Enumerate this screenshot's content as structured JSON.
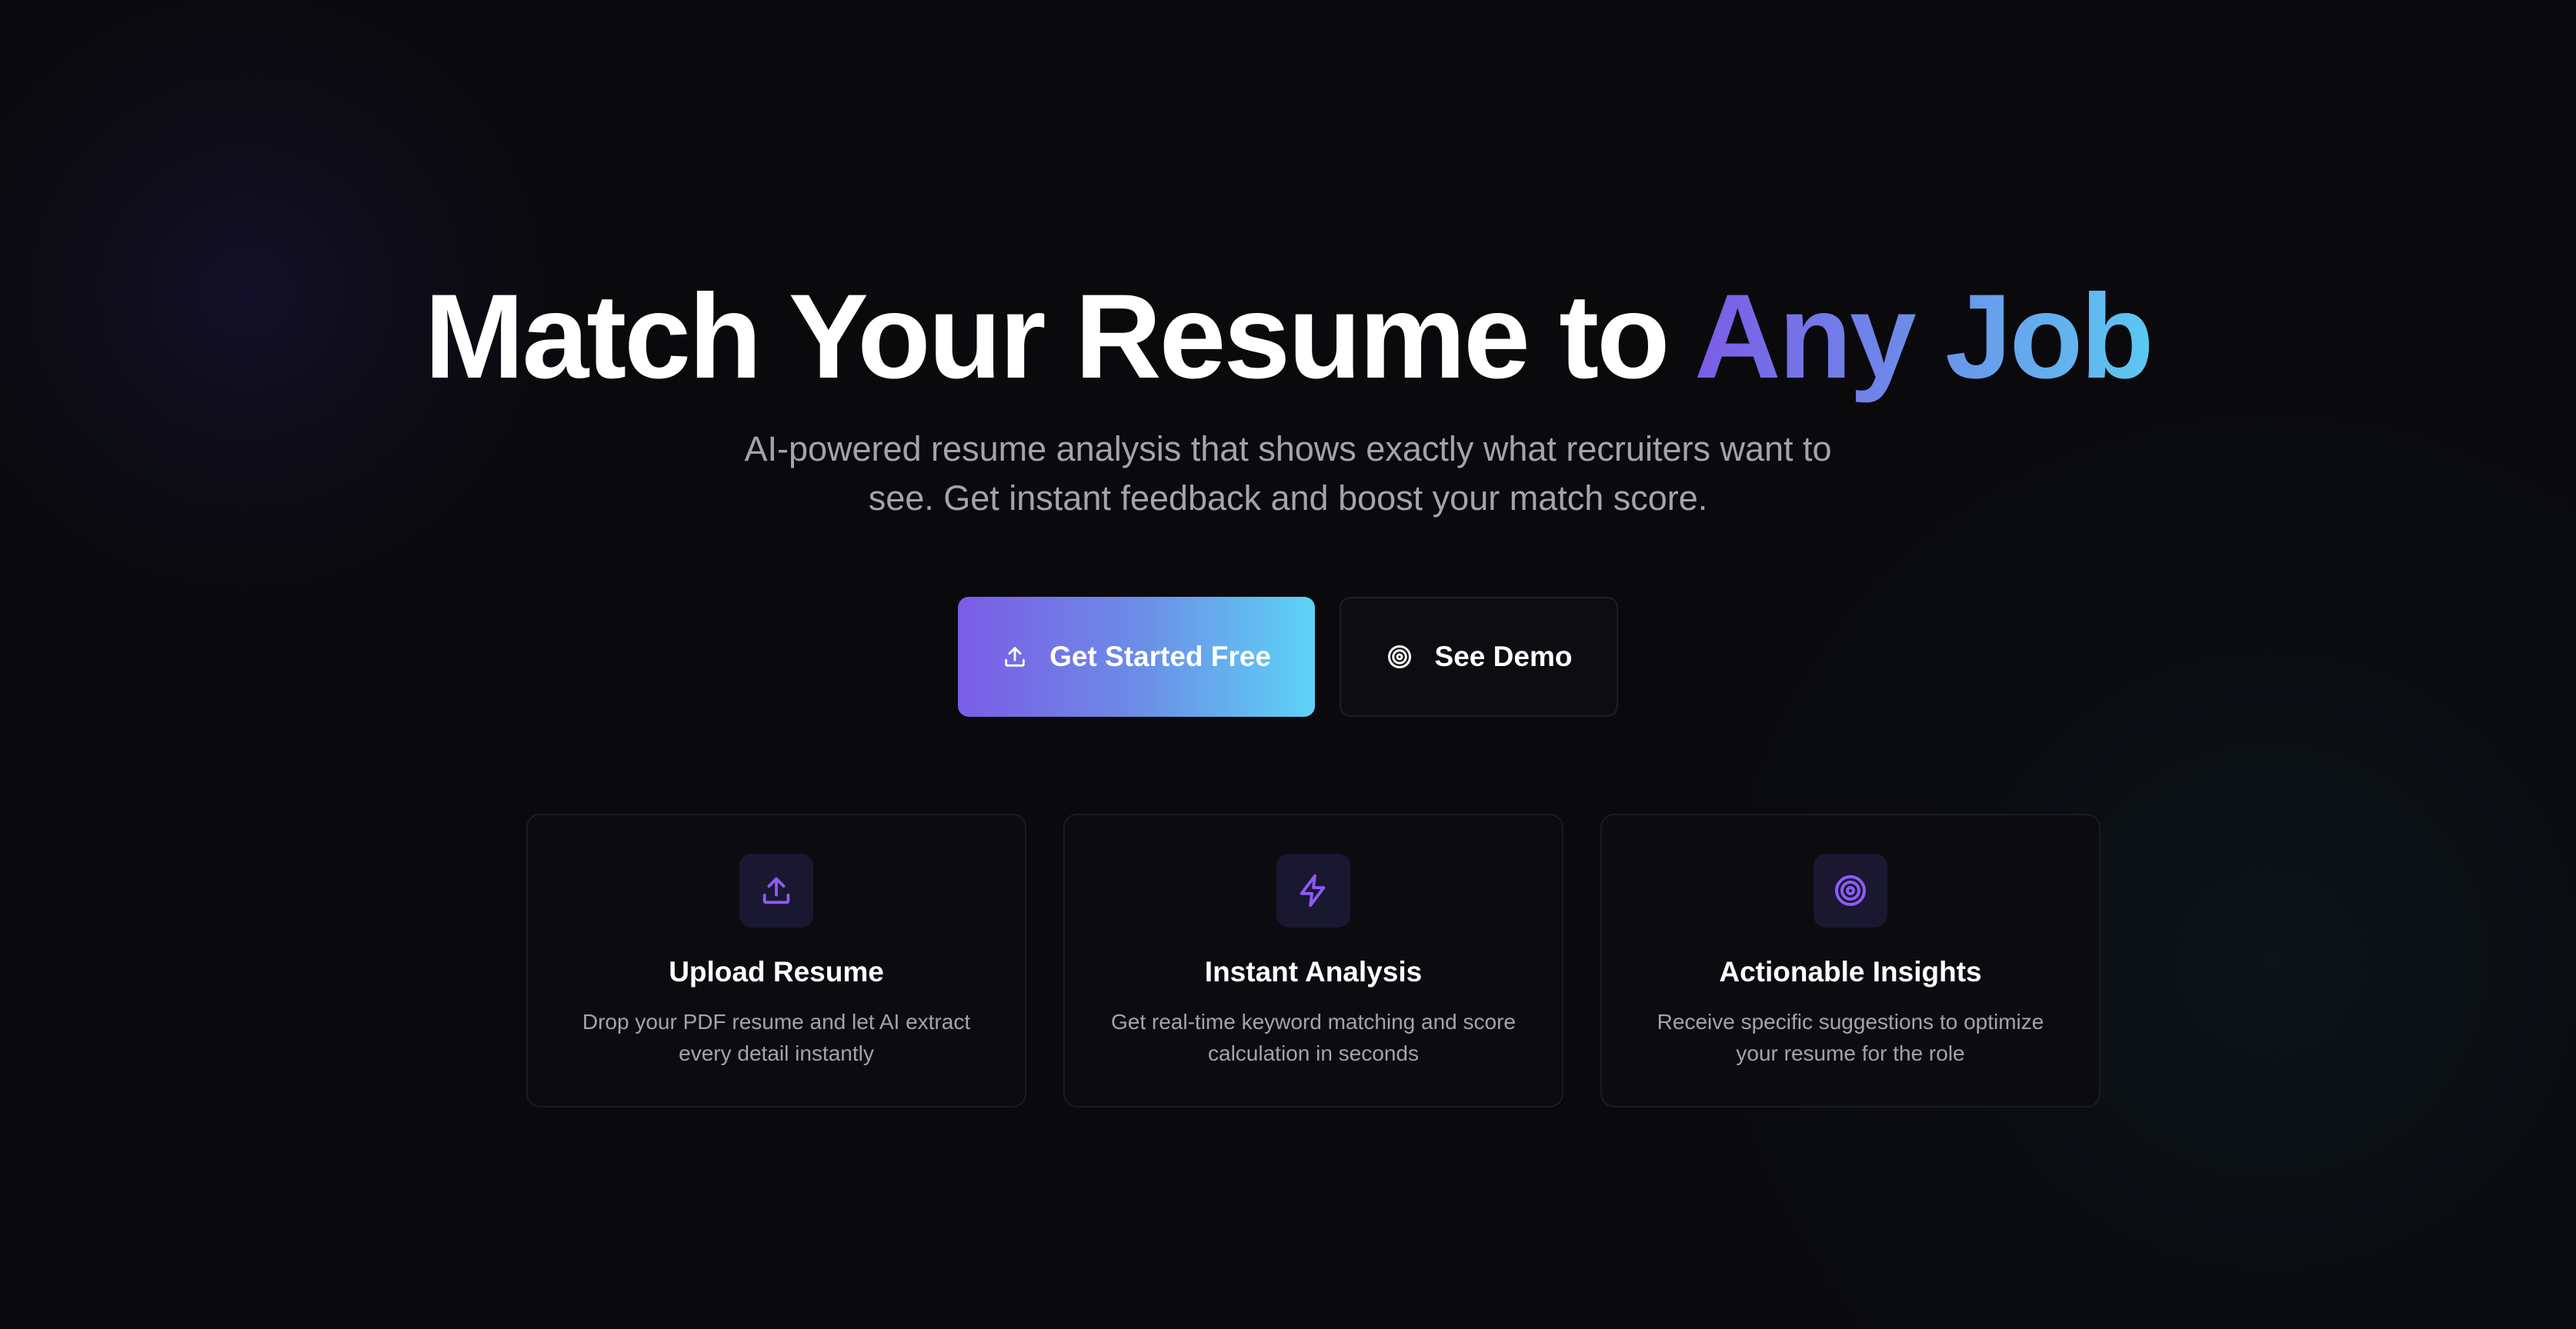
{
  "hero": {
    "title_main": "Match Your Resume to ",
    "title_accent": "Any Job",
    "subtitle": "AI-powered resume analysis that shows exactly what recruiters want to see. Get instant feedback and boost your match score."
  },
  "cta": {
    "primary_label": "Get Started Free",
    "primary_icon": "upload-icon",
    "secondary_label": "See Demo",
    "secondary_icon": "target-icon"
  },
  "features": [
    {
      "icon": "upload-icon",
      "title": "Upload Resume",
      "description": "Drop your PDF resume and let AI extract every detail instantly"
    },
    {
      "icon": "lightning-icon",
      "title": "Instant Analysis",
      "description": "Get real-time keyword matching and score calculation in seconds"
    },
    {
      "icon": "target-icon",
      "title": "Actionable Insights",
      "description": "Receive specific suggestions to optimize your resume for the role"
    }
  ],
  "colors": {
    "background": "#0a0a0d",
    "gradient_start": "#7b5ce6",
    "gradient_end": "#5dd3f6",
    "muted_text": "#a3a3ab",
    "icon_accent": "#8b5cf6"
  }
}
